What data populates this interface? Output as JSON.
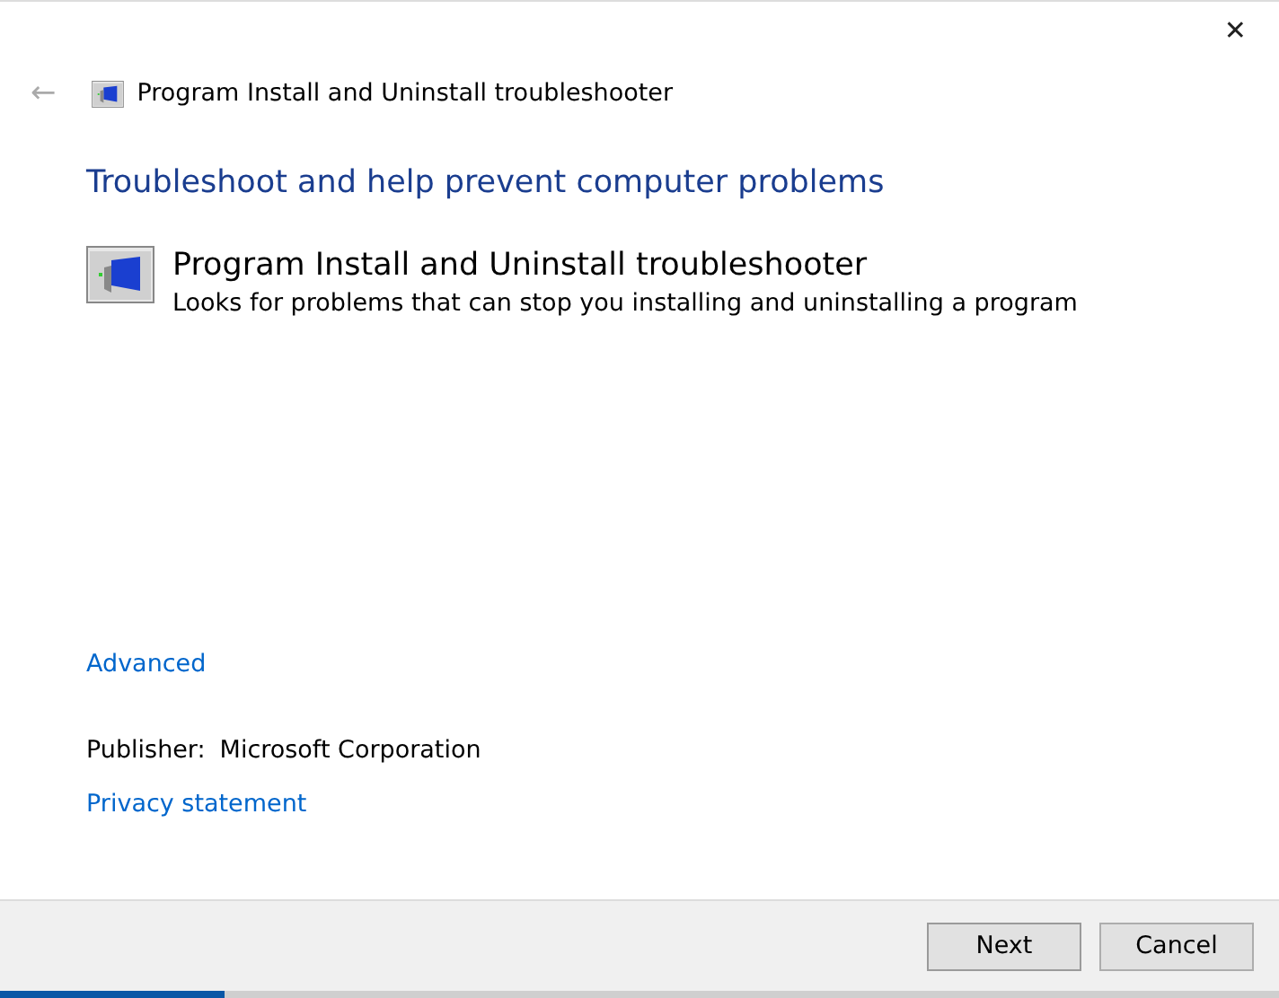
{
  "window": {
    "close": "✕"
  },
  "header": {
    "back": "←",
    "title": "Program Install and Uninstall troubleshooter"
  },
  "heading": "Troubleshoot and help prevent computer problems",
  "troubleshooter": {
    "title": "Program Install and Uninstall troubleshooter",
    "description": "Looks for problems that can stop you installing and uninstalling a program"
  },
  "advanced_link": "Advanced",
  "publisher": {
    "label": "Publisher:",
    "value": "Microsoft Corporation"
  },
  "privacy_link": "Privacy statement",
  "buttons": [
    {
      "label": "Next",
      "kind": "primary"
    },
    {
      "label": "Cancel",
      "kind": "secondary"
    }
  ],
  "progress": {
    "level": 0.175
  }
}
